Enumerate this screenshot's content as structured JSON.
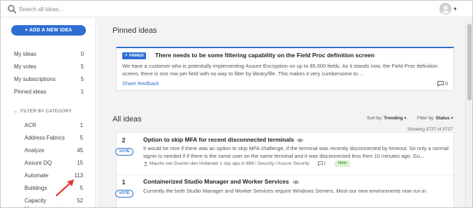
{
  "search": {
    "placeholder": "Search all ideas..."
  },
  "sidebar": {
    "new_idea_label": "+ ADD A NEW IDEA",
    "nav": [
      {
        "label": "My ideas",
        "count": "0"
      },
      {
        "label": "My votes",
        "count": "5"
      },
      {
        "label": "My subscriptions",
        "count": "5"
      },
      {
        "label": "Pinned ideas",
        "count": "1"
      }
    ],
    "filter_title": "FILTER BY CATEGORY",
    "categories": [
      {
        "label": "ACR",
        "count": "1"
      },
      {
        "label": "Address Fabrics",
        "count": "5"
      },
      {
        "label": "Analyze",
        "count": "45"
      },
      {
        "label": "Assure DQ",
        "count": "15"
      },
      {
        "label": "Automate",
        "count": "113"
      },
      {
        "label": "Buildings",
        "count": "5"
      },
      {
        "label": "Capacity Management",
        "count": "52"
      }
    ]
  },
  "pinned": {
    "heading": "Pinned ideas",
    "badge": "PINNED",
    "title": "There needs to be some filtering capability on the Field Proc definition screen",
    "description": "We have a customer who is potentially implementing Assure Encryption on up to 85,000 fields. As it stands now, the Field Proc definition screen, there is one row per field with no way to filter by library/file. This makes it very cumbersome to ...",
    "link": "Share feedback",
    "comments": "0"
  },
  "all_ideas": {
    "heading": "All ideas",
    "sort_label": "Sort by:",
    "sort_value": "Trending",
    "filter_label": "Filter by:",
    "filter_value": "Status",
    "showing": "Showing 3727 of 3727",
    "ideas": [
      {
        "votes": "2",
        "vote_label": "VOTE",
        "title": "Option to skip MFA for recent disconnected terminals",
        "description": "It would be nice if there was an option to skip MFA challenge, if the terminal was recently disconnected by timeout. So only a normal signin is needed if if there is the same user on the same terminal and it was disconnected less then 10 minutes ago. Gu...",
        "meta": "Maurits van Dueren den Hollander 1 day ago in IBM i Security / Assure Security",
        "comments": "1",
        "badge": "New"
      },
      {
        "votes": "1",
        "vote_label": "VOTE",
        "title": "Containerized Studio Manager and Worker Services",
        "description": "Currently the both Studio Manager and Worker Services require Windows Servers. Most our new environments now run in"
      }
    ]
  },
  "colors": {
    "accent": "#2f6fd3",
    "annotation": "#e53935",
    "new_badge_bg": "#dcf2d2"
  }
}
